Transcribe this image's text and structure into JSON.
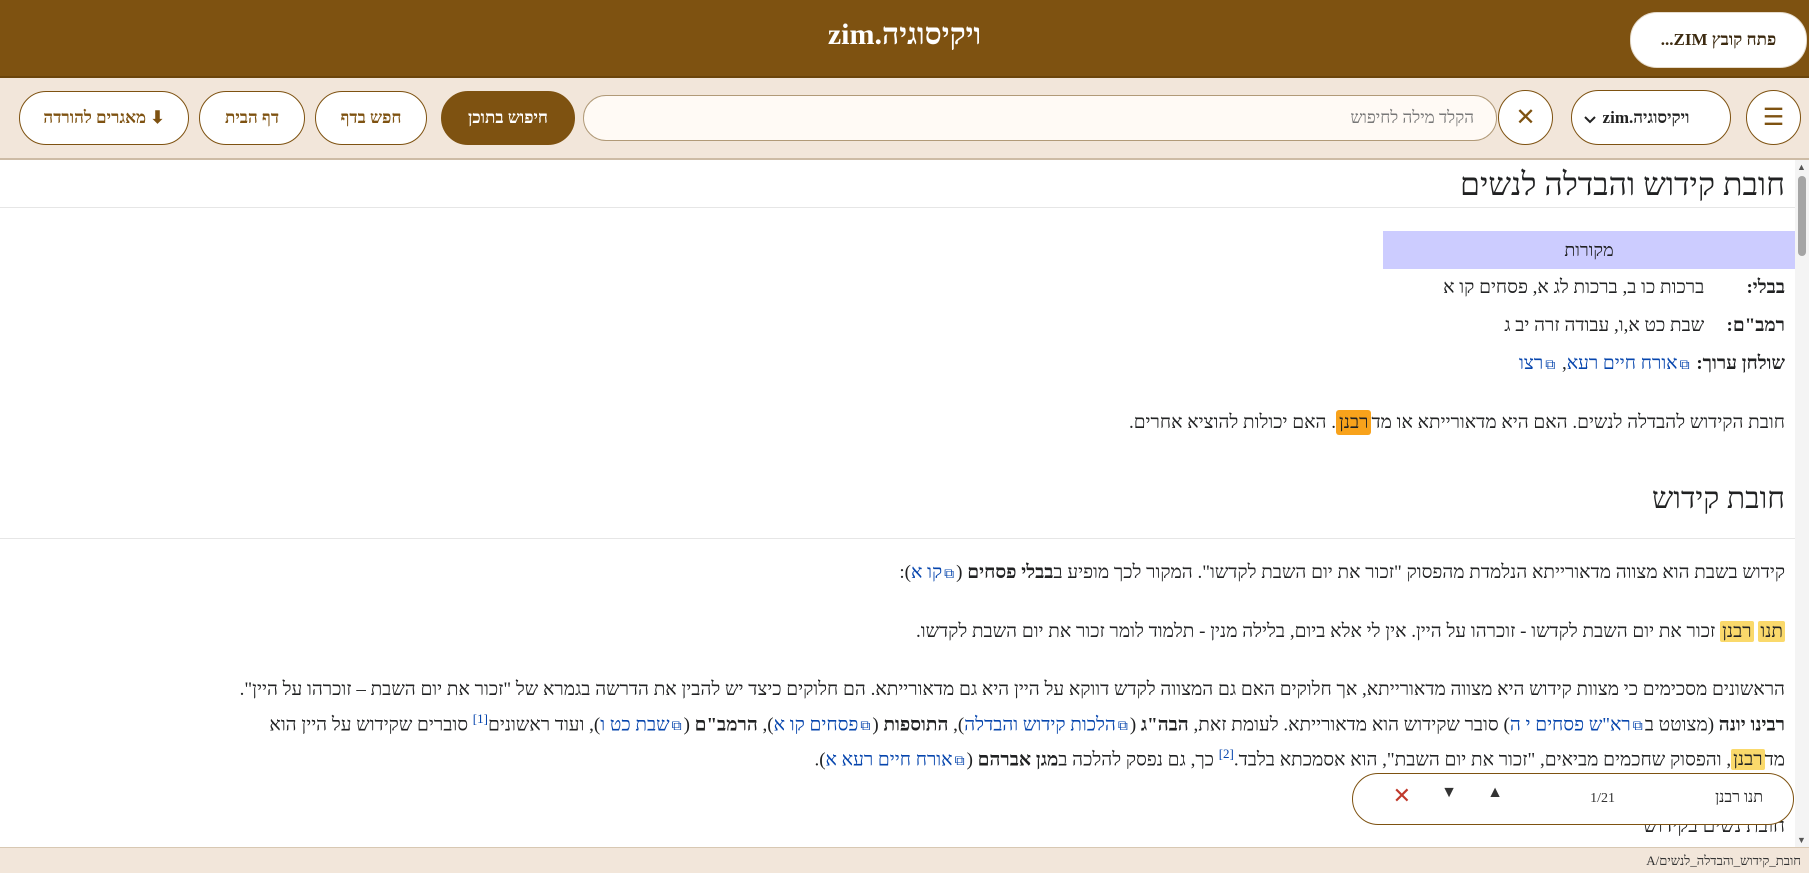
{
  "header": {
    "title": "ויקיסוגיה.zim",
    "open_file": "פתח קובץ ZIM..."
  },
  "toolbar": {
    "menu_icon": "☰",
    "library_value": "ויקיסוגיה.zim",
    "chevron": "⌄",
    "clear_icon": "✕",
    "search_placeholder": "הקלד מילה לחיפוש",
    "search_value": "",
    "search_content": "חיפוש בתוכן",
    "find_in_page": "חפש בדף",
    "home": "דף הבית",
    "download": "⬇ מאגרים להורדה"
  },
  "article": {
    "title": "חובת קידוש והבדלה לנשים",
    "sources": {
      "header": "מקורות",
      "bavli_label": "בבלי:",
      "bavli_value": "ברכות כו ב, ברכות לג א, פסחים קו א",
      "rambam_label": "רמב\"ם:",
      "rambam_value": "שבת כט א,ו, עבודה זרה יב ג",
      "sa_label": "שולחן ערוך:",
      "sa_link1": "אורח חיים רעא",
      "sa_sep": ", ",
      "sa_link2": "רצו"
    },
    "intro": {
      "before": "חובת הקידוש להבדלה לנשים. האם היא מדאורייתא או מד",
      "highlight": "רבנן",
      "after": ". האם יכולות להוציא אחרים."
    },
    "section_kiddush": "חובת קידוש",
    "p1": {
      "text": "קידוש בשבת הוא מצווה מדאורייתא הנלמדת מהפסוק \"זכור את יום השבת לקדשו\". המקור לכך מופיע ב",
      "bold": "בבלי פסחים",
      "paren_open": " (",
      "link": "קו א",
      "paren_close": "):"
    },
    "p2": {
      "hl1": "תנו",
      "hl2": "רבנן",
      "text": " זכור את יום השבת לקדשו - זוכרהו על היין. אין לי אלא ביום, בלילה מנין - תלמוד לומר זכור את יום השבת לקדשו."
    },
    "p3": {
      "line1": "הראשונים מסכימים כי מצוות קידוש היא מצווה מדאורייתא, אך חלוקים האם גם המצווה לקדש דווקא על היין היא גם מדאורייתא. הם חלוקים כיצד יש להבין את הדרשה בגמרא של \"זכור את יום השבת – זוכרהו על היין\".",
      "l2_b1": "רבינו יונה",
      "l2_t1": " (מצוטט ב",
      "l2_link1": "רא\"ש פסחים י ה",
      "l2_t2": ") סובר שקידוש הוא מדאורייתא. לעומת זאת, ",
      "l2_b2": "הבה\"ג",
      "l2_t3": " (",
      "l2_link2": "הלכות קידוש והבדלה",
      "l2_t4": "), ",
      "l2_b3": "התוספות",
      "l2_t5": " (",
      "l2_link3": "פסחים קו א",
      "l2_t6": "), ",
      "l2_b4": "הרמב\"ם",
      "l2_t7": " (",
      "l2_link4": "שבת כט ו",
      "l2_t8": "), ועוד ראשונים",
      "l2_sup": "[1]",
      "l2_t9": " סוברים שקידוש על היין הוא",
      "l3_t1": "מד",
      "l3_hl": "רבנן",
      "l3_t2": ", והפסוק שחכמים מביאים, \"זכור את יום השבת\", הוא אסמכתא בלבד.",
      "l3_sup": "[2]",
      "l3_t3": " כך, גם נפסק להלכה ב",
      "l3_b1": "מגן אברהם",
      "l3_t4": " (",
      "l3_link": "אורח חיים רעא א",
      "l3_t5": ")."
    },
    "section_women": "חובת נשים בקידוש"
  },
  "findbar": {
    "query": "תנו רבנן",
    "count": "1/21",
    "prev": "▲",
    "next": "▼",
    "close": "✕"
  },
  "status": {
    "url": "A/חובת_קידוש_והבדלה_לנשים"
  },
  "colors": {
    "header_bg": "#7e5211",
    "toolbar_bg": "#f2e6da",
    "highlight": "#fad96b",
    "highlight_current": "#f8a21b",
    "link": "#0645ad",
    "sources_header_bg": "#ccccff"
  }
}
